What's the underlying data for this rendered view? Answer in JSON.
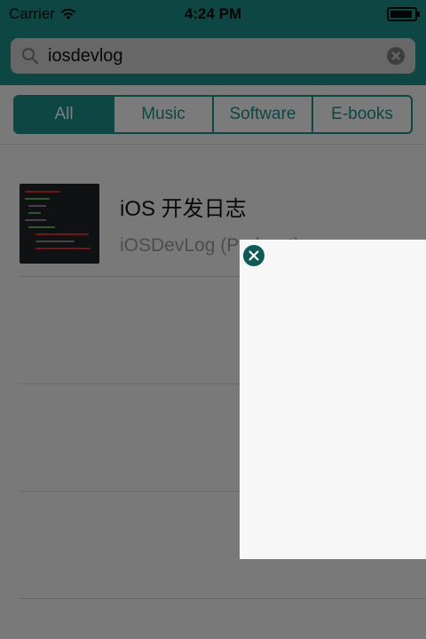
{
  "status_bar": {
    "carrier": "Carrier",
    "time": "4:24 PM"
  },
  "search": {
    "query": "iosdevlog"
  },
  "segments": [
    {
      "label": "All",
      "active": true
    },
    {
      "label": "Music",
      "active": false
    },
    {
      "label": "Software",
      "active": false
    },
    {
      "label": "E-books",
      "active": false
    }
  ],
  "results": [
    {
      "title": "iOS 开发日志",
      "subtitle": "iOSDevLog (Podcast)",
      "thumb_icon": "code-editor-thumbnail"
    }
  ],
  "colors": {
    "accent": "#1a8c86",
    "close_button": "#0f5957",
    "panel_bg": "#f7f7f7"
  },
  "popup": {
    "close_icon": "close-icon"
  }
}
